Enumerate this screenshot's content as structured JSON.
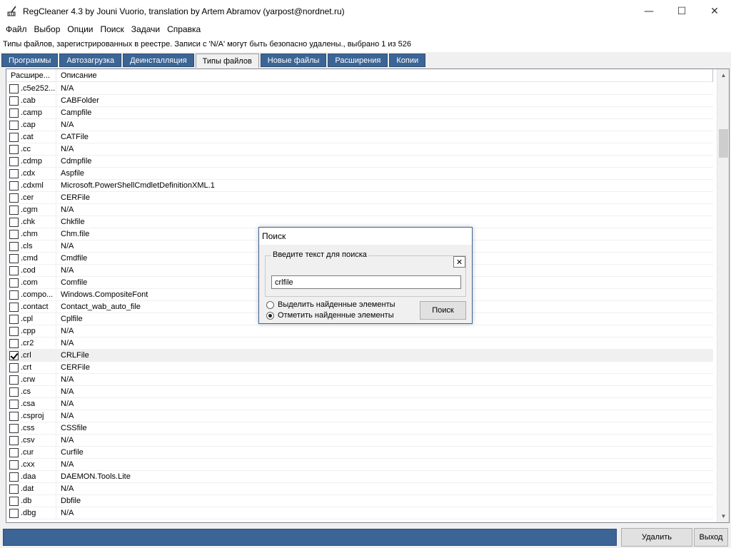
{
  "window": {
    "title": "RegCleaner 4.3 by Jouni Vuorio, translation by Artem Abramov (yarpost@nordnet.ru)",
    "minimize": "—",
    "maximize": "☐",
    "close": "✕"
  },
  "menu": [
    "Файл",
    "Выбор",
    "Опции",
    "Поиск",
    "Задачи",
    "Справка"
  ],
  "status": "Типы файлов, зарегистрированных в реестре. Записи с 'N/A' могут быть безопасно удалены., выбрано 1 из 526",
  "tabs": [
    "Программы",
    "Автозагрузка",
    "Деинсталляция",
    "Типы файлов",
    "Новые файлы",
    "Расширения",
    "Копии"
  ],
  "active_tab": "Типы файлов",
  "list": {
    "columns": [
      "Расшире...",
      "Описание"
    ],
    "rows": [
      {
        "ext": ".c5e252...",
        "desc": "N/A",
        "checked": false
      },
      {
        "ext": ".cab",
        "desc": "CABFolder",
        "checked": false
      },
      {
        "ext": ".camp",
        "desc": "Campfile",
        "checked": false
      },
      {
        "ext": ".cap",
        "desc": "N/A",
        "checked": false
      },
      {
        "ext": ".cat",
        "desc": "CATFile",
        "checked": false
      },
      {
        "ext": ".cc",
        "desc": "N/A",
        "checked": false
      },
      {
        "ext": ".cdmp",
        "desc": "Cdmpfile",
        "checked": false
      },
      {
        "ext": ".cdx",
        "desc": "Aspfile",
        "checked": false
      },
      {
        "ext": ".cdxml",
        "desc": "Microsoft.PowerShellCmdletDefinitionXML.1",
        "checked": false
      },
      {
        "ext": ".cer",
        "desc": "CERFile",
        "checked": false
      },
      {
        "ext": ".cgm",
        "desc": "N/A",
        "checked": false
      },
      {
        "ext": ".chk",
        "desc": "Chkfile",
        "checked": false
      },
      {
        "ext": ".chm",
        "desc": "Chm.file",
        "checked": false
      },
      {
        "ext": ".cls",
        "desc": "N/A",
        "checked": false
      },
      {
        "ext": ".cmd",
        "desc": "Cmdfile",
        "checked": false
      },
      {
        "ext": ".cod",
        "desc": "N/A",
        "checked": false
      },
      {
        "ext": ".com",
        "desc": "Comfile",
        "checked": false
      },
      {
        "ext": ".compo...",
        "desc": "Windows.CompositeFont",
        "checked": false
      },
      {
        "ext": ".contact",
        "desc": "Contact_wab_auto_file",
        "checked": false
      },
      {
        "ext": ".cpl",
        "desc": "Cplfile",
        "checked": false
      },
      {
        "ext": ".cpp",
        "desc": "N/A",
        "checked": false
      },
      {
        "ext": ".cr2",
        "desc": "N/A",
        "checked": false
      },
      {
        "ext": ".crl",
        "desc": "CRLFile",
        "checked": true
      },
      {
        "ext": ".crt",
        "desc": "CERFile",
        "checked": false
      },
      {
        "ext": ".crw",
        "desc": "N/A",
        "checked": false
      },
      {
        "ext": ".cs",
        "desc": "N/A",
        "checked": false
      },
      {
        "ext": ".csa",
        "desc": "N/A",
        "checked": false
      },
      {
        "ext": ".csproj",
        "desc": "N/A",
        "checked": false
      },
      {
        "ext": ".css",
        "desc": "CSSfile",
        "checked": false
      },
      {
        "ext": ".csv",
        "desc": "N/A",
        "checked": false
      },
      {
        "ext": ".cur",
        "desc": "Curfile",
        "checked": false
      },
      {
        "ext": ".cxx",
        "desc": "N/A",
        "checked": false
      },
      {
        "ext": ".daa",
        "desc": "DAEMON.Tools.Lite",
        "checked": false
      },
      {
        "ext": ".dat",
        "desc": "N/A",
        "checked": false
      },
      {
        "ext": ".db",
        "desc": "Dbfile",
        "checked": false
      },
      {
        "ext": ".dbg",
        "desc": "N/A",
        "checked": false
      }
    ]
  },
  "dialog": {
    "title": "Поиск",
    "group_label": "Введите текст для поиска",
    "close": "✕",
    "input_value": "crlfile",
    "options": [
      {
        "label": "Выделить найденные элементы",
        "selected": false
      },
      {
        "label": "Отметить найденные элементы",
        "selected": true
      }
    ],
    "search_button": "Поиск"
  },
  "bottom": {
    "delete_button": "Удалить",
    "exit_button": "Выход"
  },
  "colors": {
    "accent": "#3c6596"
  },
  "icons": {
    "app": "regcleaner-broom-icon",
    "scroll_up": "▲",
    "scroll_down": "▼"
  }
}
